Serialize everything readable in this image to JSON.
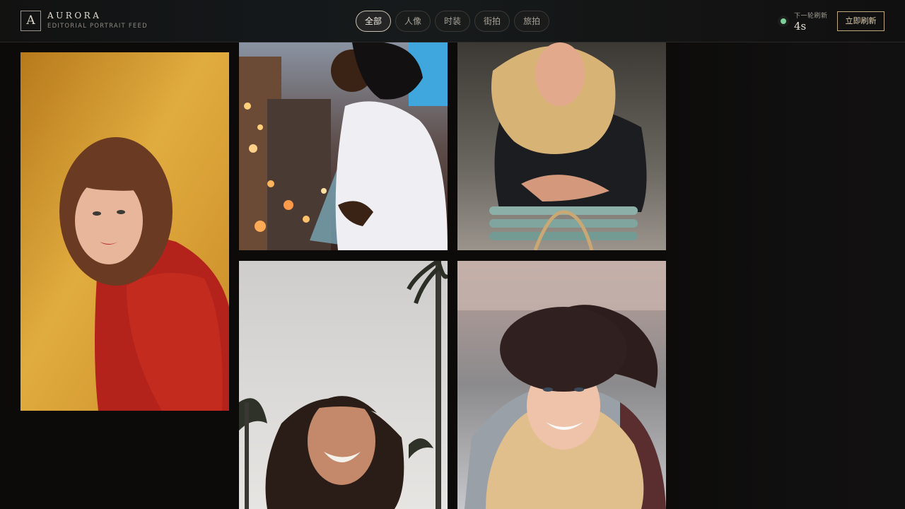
{
  "brand": {
    "logo_letter": "A",
    "title": "AURORA",
    "subtitle": "EDITORIAL PORTRAIT FEED"
  },
  "tabs": [
    {
      "label": "全部",
      "active": true
    },
    {
      "label": "人像",
      "active": false
    },
    {
      "label": "时装",
      "active": false
    },
    {
      "label": "街拍",
      "active": false
    },
    {
      "label": "旅拍",
      "active": false
    }
  ],
  "refresh": {
    "label": "下一轮刷新",
    "countdown": "4s",
    "button_label": "立即刷新",
    "status_color": "#7ccf98"
  },
  "colors": {
    "background": "#0c0b0a",
    "accent": "#bfa77e"
  },
  "gallery": [
    {
      "subject": "curly-hair-woman-red-sweater-yellow-backdrop"
    },
    {
      "subject": "woman-balcony-city-lights"
    },
    {
      "subject": "blonde-woman-on-chair"
    },
    {
      "subject": "smiling-woman-palm-trees"
    },
    {
      "subject": "smiling-woman-beanie"
    }
  ]
}
